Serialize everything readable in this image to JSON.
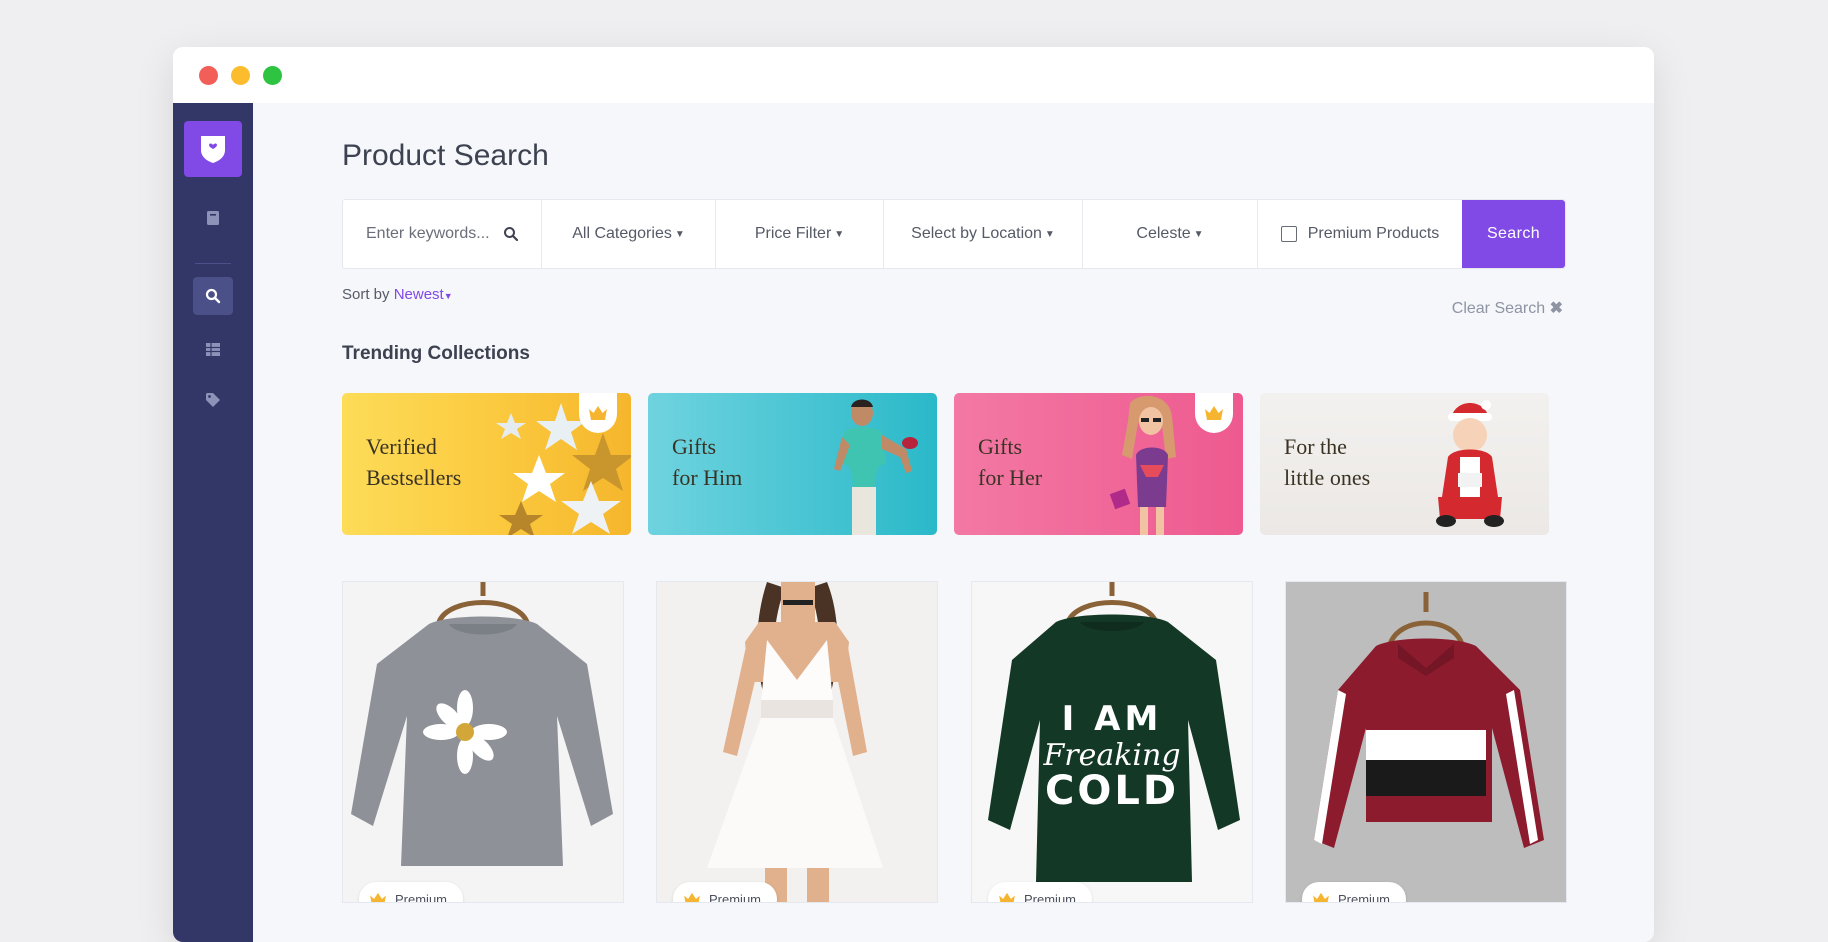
{
  "page": {
    "title": "Product Search"
  },
  "search": {
    "keywords_placeholder": "Enter keywords...",
    "categories": "All Categories",
    "price_filter": "Price Filter",
    "location": "Select by Location",
    "user": "Celeste",
    "premium_checkbox_label": "Premium Products",
    "premium_checked": false,
    "search_button": "Search"
  },
  "sort": {
    "label": "Sort by",
    "value": "Newest"
  },
  "clear_search": "Clear Search",
  "trending": {
    "title": "Trending Collections",
    "items": [
      {
        "line1": "Verified",
        "line2": "Bestsellers",
        "premium": true
      },
      {
        "line1": "Gifts",
        "line2": "for Him",
        "premium": false
      },
      {
        "line1": "Gifts",
        "line2": "for Her",
        "premium": true
      },
      {
        "line1": "For the",
        "line2": "little ones",
        "premium": false
      }
    ]
  },
  "products": [
    {
      "name": "grey-daisy-sweater",
      "badge": "Premium"
    },
    {
      "name": "white-lace-dress",
      "badge": "Premium"
    },
    {
      "name": "green-i-am-freaking-cold-sweater",
      "badge": "Premium",
      "print_line1": "I AM",
      "print_line2": "Freaking",
      "print_line3": "COLD"
    },
    {
      "name": "red-colorblock-pullover",
      "badge": "Premium"
    }
  ],
  "colors": {
    "accent": "#8149e5",
    "sidebar": "#323767",
    "background": "#f6f7fb"
  },
  "icons": {
    "logo": "shield-heart-icon",
    "sidebar": [
      "notebook-icon",
      "search-icon",
      "table-icon",
      "tag-icon"
    ],
    "crown": "crown-icon"
  }
}
